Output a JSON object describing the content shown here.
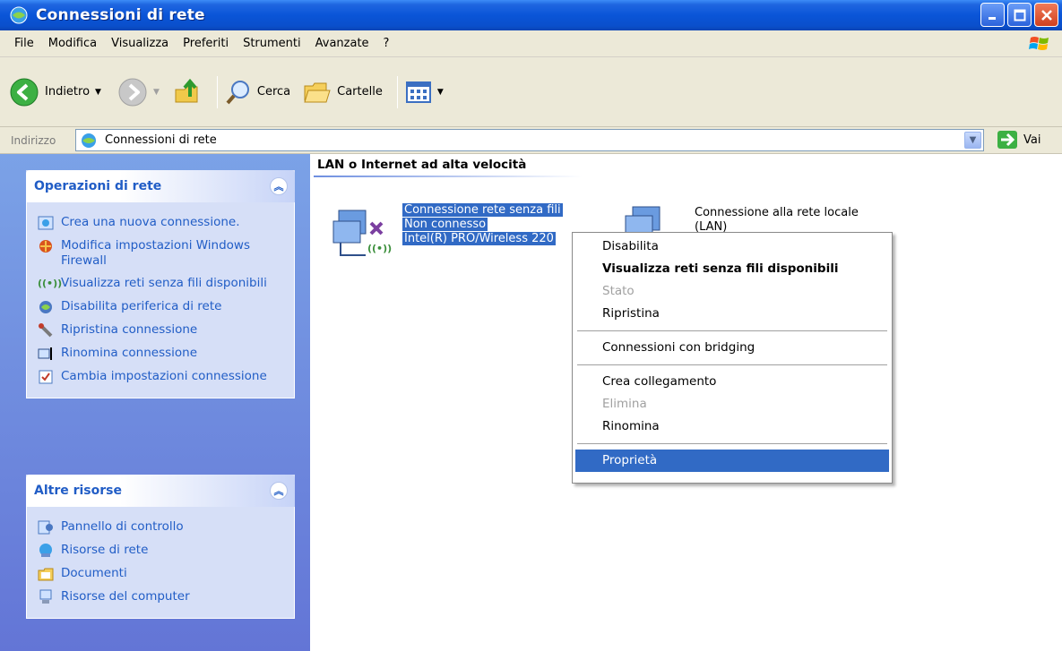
{
  "window": {
    "title": "Connessioni di rete"
  },
  "menubar": {
    "items": [
      "File",
      "Modifica",
      "Visualizza",
      "Preferiti",
      "Strumenti",
      "Avanzate",
      "?"
    ]
  },
  "toolbar": {
    "back_label": "Indietro",
    "search_label": "Cerca",
    "folders_label": "Cartelle"
  },
  "address": {
    "label": "Indirizzo",
    "value": "Connessioni di rete",
    "go_label": "Vai"
  },
  "network_tasks": {
    "title": "Operazioni di rete",
    "items": [
      {
        "label": "Crea una nuova connessione.",
        "icon": "new-connection-icon"
      },
      {
        "label": "Modifica impostazioni Windows Firewall",
        "icon": "firewall-icon"
      },
      {
        "label": "Visualizza reti senza fili disponibili",
        "icon": "wireless-icon"
      },
      {
        "label": "Disabilita periferica di rete",
        "icon": "disable-device-icon"
      },
      {
        "label": "Ripristina connessione",
        "icon": "repair-icon"
      },
      {
        "label": "Rinomina connessione",
        "icon": "rename-icon"
      },
      {
        "label": "Cambia impostazioni connessione",
        "icon": "settings-icon"
      }
    ]
  },
  "other_places": {
    "title": "Altre risorse",
    "items": [
      {
        "label": "Pannello di controllo",
        "icon": "control-panel-icon"
      },
      {
        "label": "Risorse di rete",
        "icon": "network-places-icon"
      },
      {
        "label": "Documenti",
        "icon": "documents-icon"
      },
      {
        "label": "Risorse del computer",
        "icon": "my-computer-icon"
      }
    ]
  },
  "content": {
    "group_title": "LAN o Internet ad alta velocità",
    "wireless": {
      "name": "Connessione rete senza fili",
      "status": "Non connesso",
      "device": "Intel(R) PRO/Wireless 220"
    },
    "lan": {
      "name": "Connessione alla rete locale",
      "name_line2": "(LAN)"
    }
  },
  "context_menu": {
    "items": [
      {
        "label": "Disabilita",
        "state": "normal"
      },
      {
        "label": "Visualizza reti senza fili disponibili",
        "state": "bold"
      },
      {
        "label": "Stato",
        "state": "disabled"
      },
      {
        "label": "Ripristina",
        "state": "normal"
      },
      {
        "label": "Connessioni con bridging",
        "state": "normal"
      },
      {
        "label": "Crea collegamento",
        "state": "normal"
      },
      {
        "label": "Elimina",
        "state": "disabled"
      },
      {
        "label": "Rinomina",
        "state": "normal"
      },
      {
        "label": "Proprietà",
        "state": "highlighted"
      }
    ]
  },
  "colors": {
    "titlebar": "#0a55d8",
    "selection": "#316ac5",
    "task_link": "#215dc6",
    "pane_background": "#6f8cdc"
  }
}
